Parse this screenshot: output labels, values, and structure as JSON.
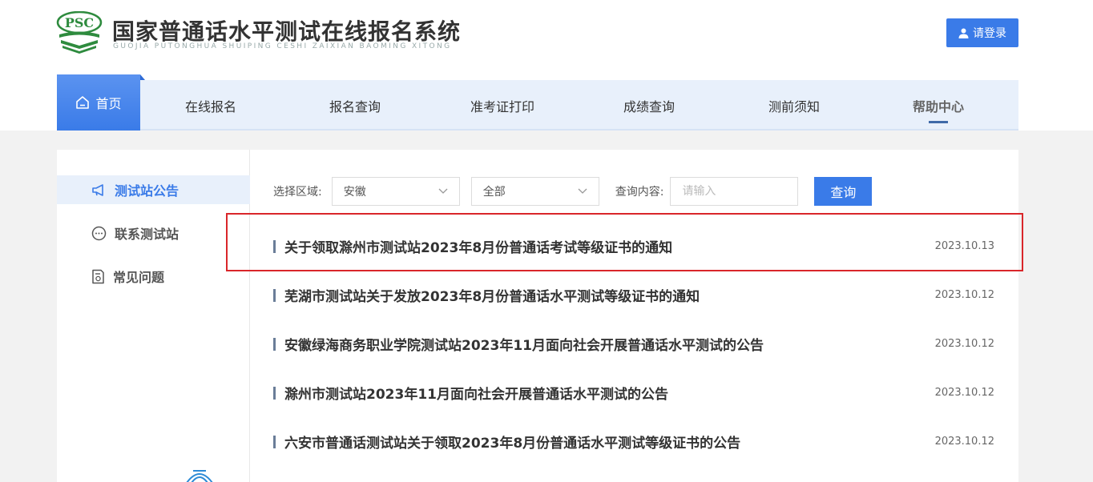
{
  "header": {
    "logo_text": "PSC",
    "title": "国家普通话水平测试在线报名系统",
    "title_pinyin": "GUOJIA PUTONGHUA SHUIPING CESHI ZAIXIAN BAOMING XITONG",
    "login_label": "请登录"
  },
  "nav": {
    "items": [
      {
        "label": "首页",
        "icon": "home-icon",
        "active": true
      },
      {
        "label": "在线报名"
      },
      {
        "label": "报名查询"
      },
      {
        "label": "准考证打印"
      },
      {
        "label": "成绩查询"
      },
      {
        "label": "测前须知"
      },
      {
        "label": "帮助中心"
      }
    ]
  },
  "sidebar": {
    "items": [
      {
        "label": "测试站公告",
        "icon": "megaphone-icon",
        "active": true
      },
      {
        "label": "联系测试站",
        "icon": "chat-bubble-icon"
      },
      {
        "label": "常见问题",
        "icon": "document-question-icon"
      }
    ]
  },
  "filter": {
    "region_label": "选择区域:",
    "region_value": "安徽",
    "sub_value": "全部",
    "query_label": "查询内容:",
    "query_placeholder": "请输入",
    "query_button": "查询"
  },
  "notices": [
    {
      "title": "关于领取滁州市测试站2023年8月份普通话考试等级证书的通知",
      "date": "2023.10.13"
    },
    {
      "title": "芜湖市测试站关于发放2023年8月份普通话水平测试等级证书的通知",
      "date": "2023.10.12"
    },
    {
      "title": "安徽绿海商务职业学院测试站2023年11月面向社会开展普通话水平测试的公告",
      "date": "2023.10.12"
    },
    {
      "title": "滁州市测试站2023年11月面向社会开展普通话水平测试的公告",
      "date": "2023.10.12"
    },
    {
      "title": "六安市普通话测试站关于领取2023年8月份普通话水平测试等级证书的公告",
      "date": "2023.10.12"
    }
  ],
  "colors": {
    "accent": "#3a7be8",
    "nav_bg": "#e8f0fb",
    "highlight_border": "#d9262a"
  }
}
